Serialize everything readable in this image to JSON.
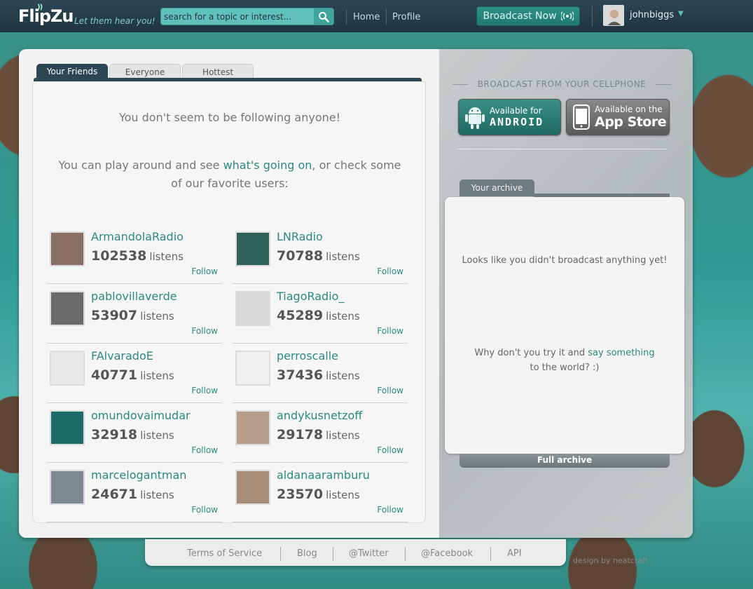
{
  "header": {
    "logo": "FlipZu",
    "tagline": "Let them hear you!",
    "search_placeholder": "search for a topic or interest...",
    "nav": [
      "Home",
      "Profile"
    ],
    "broadcast_label": "Broadcast Now",
    "username": "johnbiggs",
    "colors": {
      "bar": "#2d4654",
      "accent": "#5fc1b8"
    }
  },
  "tabs": [
    "Your Friends",
    "Everyone",
    "Hottest"
  ],
  "friends": {
    "not_following": "You don't seem to be following anyone!",
    "play_prefix": "You can play around and see",
    "play_link": "what's going on",
    "play_suffix": ", or check some of our favorite users:",
    "listens_label": "listens",
    "follow_label": "Follow",
    "users": [
      {
        "name": "ArmandolaRadio",
        "listens": "102538"
      },
      {
        "name": "LNRadio",
        "listens": "70788"
      },
      {
        "name": "pablovillaverde",
        "listens": "53907"
      },
      {
        "name": "TiagoRadio_",
        "listens": "45289"
      },
      {
        "name": "FAlvaradoE",
        "listens": "40771"
      },
      {
        "name": "perroscalle",
        "listens": "37436"
      },
      {
        "name": "omundovaimudar",
        "listens": "32918"
      },
      {
        "name": "andykusnetzoff",
        "listens": "29178"
      },
      {
        "name": "marcelogantman",
        "listens": "24671"
      },
      {
        "name": "aldanaaramburu",
        "listens": "23570"
      }
    ]
  },
  "sidebar": {
    "cellphone_title": "BROADCAST FROM YOUR CELLPHONE",
    "android_small": "Available for",
    "android_big": "ANDROID",
    "appstore_small": "Available on the",
    "appstore_big": "App Store",
    "archive_tab": "Your archive",
    "archive_empty": "Looks like you didn't broadcast anything yet!",
    "try_prefix": "Why don't you try it and",
    "try_link": "say something",
    "try_suffix": "to the world? :)",
    "full_archive": "Full archive"
  },
  "footer": {
    "links": [
      "Terms of Service",
      "Blog",
      "@Twitter",
      "@Facebook",
      "API"
    ],
    "credit": "design by neatcraft"
  }
}
